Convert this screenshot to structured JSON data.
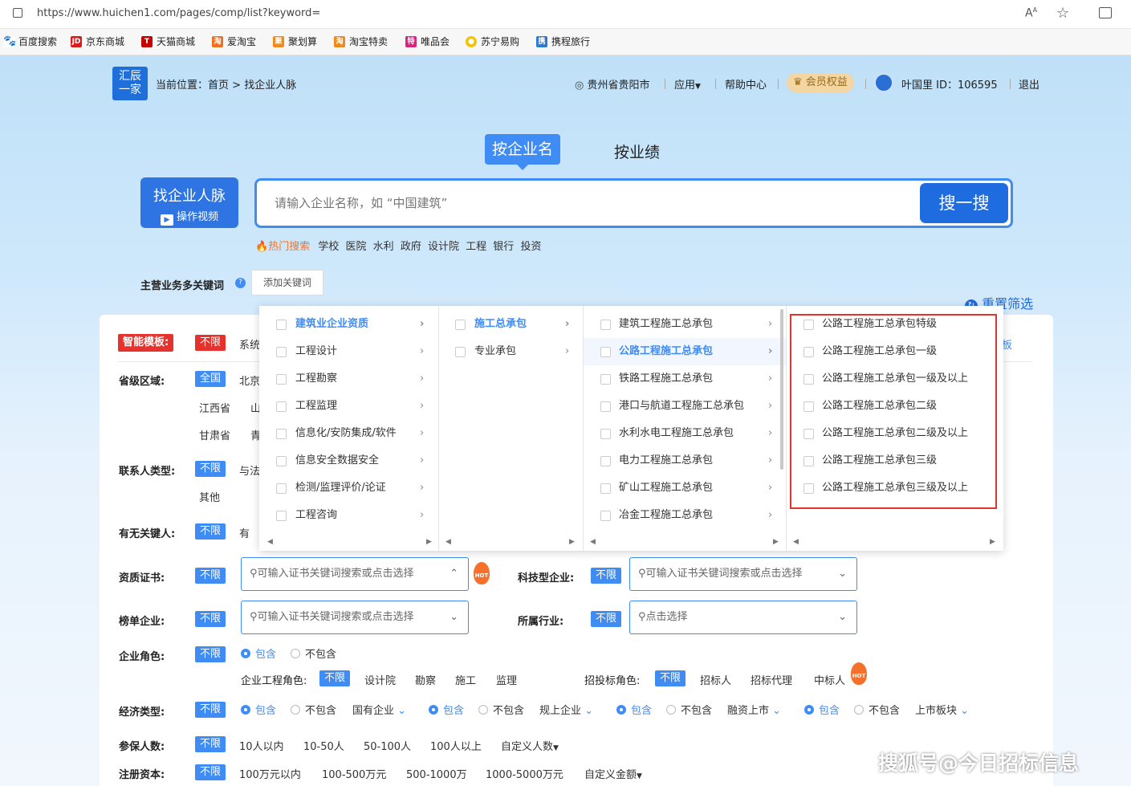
{
  "browser": {
    "url": "https://www.huichen1.com/pages/comp/list?keyword=",
    "bookmarks": [
      "百度搜索",
      "京东商城",
      "天猫商城",
      "爱淘宝",
      "聚划算",
      "淘宝特卖",
      "唯品会",
      "苏宁易购",
      "携程旅行"
    ]
  },
  "header": {
    "logo_line1": "汇辰",
    "logo_line2": "一家",
    "breadcrumb_prefix": "当前位置：",
    "breadcrumb_home": "首页",
    "breadcrumb_sep": ">",
    "breadcrumb_current": "找企业人脉",
    "location": "贵州省贵阳市",
    "apps": "应用",
    "help": "帮助中心",
    "vip": "会员权益",
    "user": "叶国里 ID：106595",
    "logout": "退出"
  },
  "search": {
    "tab_active": "按企业名",
    "tab_other": "按业绩",
    "side_title": "找企业人脉",
    "side_video": "操作视频",
    "placeholder": "请输入企业名称，如 “中国建筑”",
    "button": "搜一搜",
    "hot_label": "热门搜索",
    "hot_items": [
      "学校",
      "医院",
      "水利",
      "政府",
      "设计院",
      "工程",
      "银行",
      "投资"
    ]
  },
  "keywords": {
    "label": "主营业务多关键词",
    "add_button": "添加关键词",
    "reset": "重置筛选"
  },
  "filters": {
    "smart_template": "智能模板:",
    "unlimited": "不限",
    "system_partial": "系统",
    "template_partial": "板",
    "province_label": "省级区域:",
    "province_all": "全国",
    "province_partial": [
      "北京",
      "江西省",
      "山",
      "甘肃省",
      "青"
    ],
    "contact_type_label": "联系人类型:",
    "contact_partial": "与法",
    "contact_other": "其他",
    "key_person_label": "有无关键人:",
    "key_person_has": "有",
    "cert_label": "资质证书:",
    "cert_placeholder": "可输入证书关键词搜索或点击选择",
    "tech_label": "科技型企业:",
    "tech_placeholder": "可输入证书关键词搜索或点击选择",
    "rank_label": "榜单企业:",
    "rank_placeholder": "可输入证书关键词搜索或点击选择",
    "industry_label": "所属行业:",
    "industry_placeholder": "点击选择",
    "role_label": "企业角色:",
    "include": "包含",
    "exclude": "不包含",
    "eng_role_label": "企业工程角色:",
    "eng_roles": [
      "设计院",
      "勘察",
      "施工",
      "监理"
    ],
    "bid_role_label": "招投标角色:",
    "bid_roles": [
      "招标人",
      "招标代理",
      "中标人"
    ],
    "econ_label": "经济类型:",
    "econ_selects": [
      "国有企业",
      "规上企业",
      "融资上市",
      "上市板块"
    ],
    "insured_label": "参保人数:",
    "insured_options": [
      "10人以内",
      "10-50人",
      "50-100人",
      "100人以上",
      "自定义人数"
    ],
    "capital_label": "注册资本:",
    "capital_options": [
      "100万元以内",
      "100-500万元",
      "500-1000万",
      "1000-5000万元",
      "自定义金额"
    ],
    "hot_badge": "HOT"
  },
  "cascade": {
    "col1": [
      "建筑业企业资质",
      "工程设计",
      "工程勘察",
      "工程监理",
      "信息化/安防集成/软件",
      "信息安全数据安全",
      "检测/监理评价/论证",
      "工程咨询"
    ],
    "col2": [
      "施工总承包",
      "专业承包"
    ],
    "col3": [
      "建筑工程施工总承包",
      "公路工程施工总承包",
      "铁路工程施工总承包",
      "港口与航道工程施工总承包",
      "水利水电工程施工总承包",
      "电力工程施工总承包",
      "矿山工程施工总承包",
      "冶金工程施工总承包"
    ],
    "col4": [
      "公路工程施工总承包特级",
      "公路工程施工总承包一级",
      "公路工程施工总承包一级及以上",
      "公路工程施工总承包二级",
      "公路工程施工总承包二级及以上",
      "公路工程施工总承包三级",
      "公路工程施工总承包三级及以上"
    ]
  },
  "watermark": "搜狐号@今日招标信息",
  "colors": {
    "accent": "#3f8cf5",
    "red": "#e5322d",
    "hot": "#f5712b"
  }
}
